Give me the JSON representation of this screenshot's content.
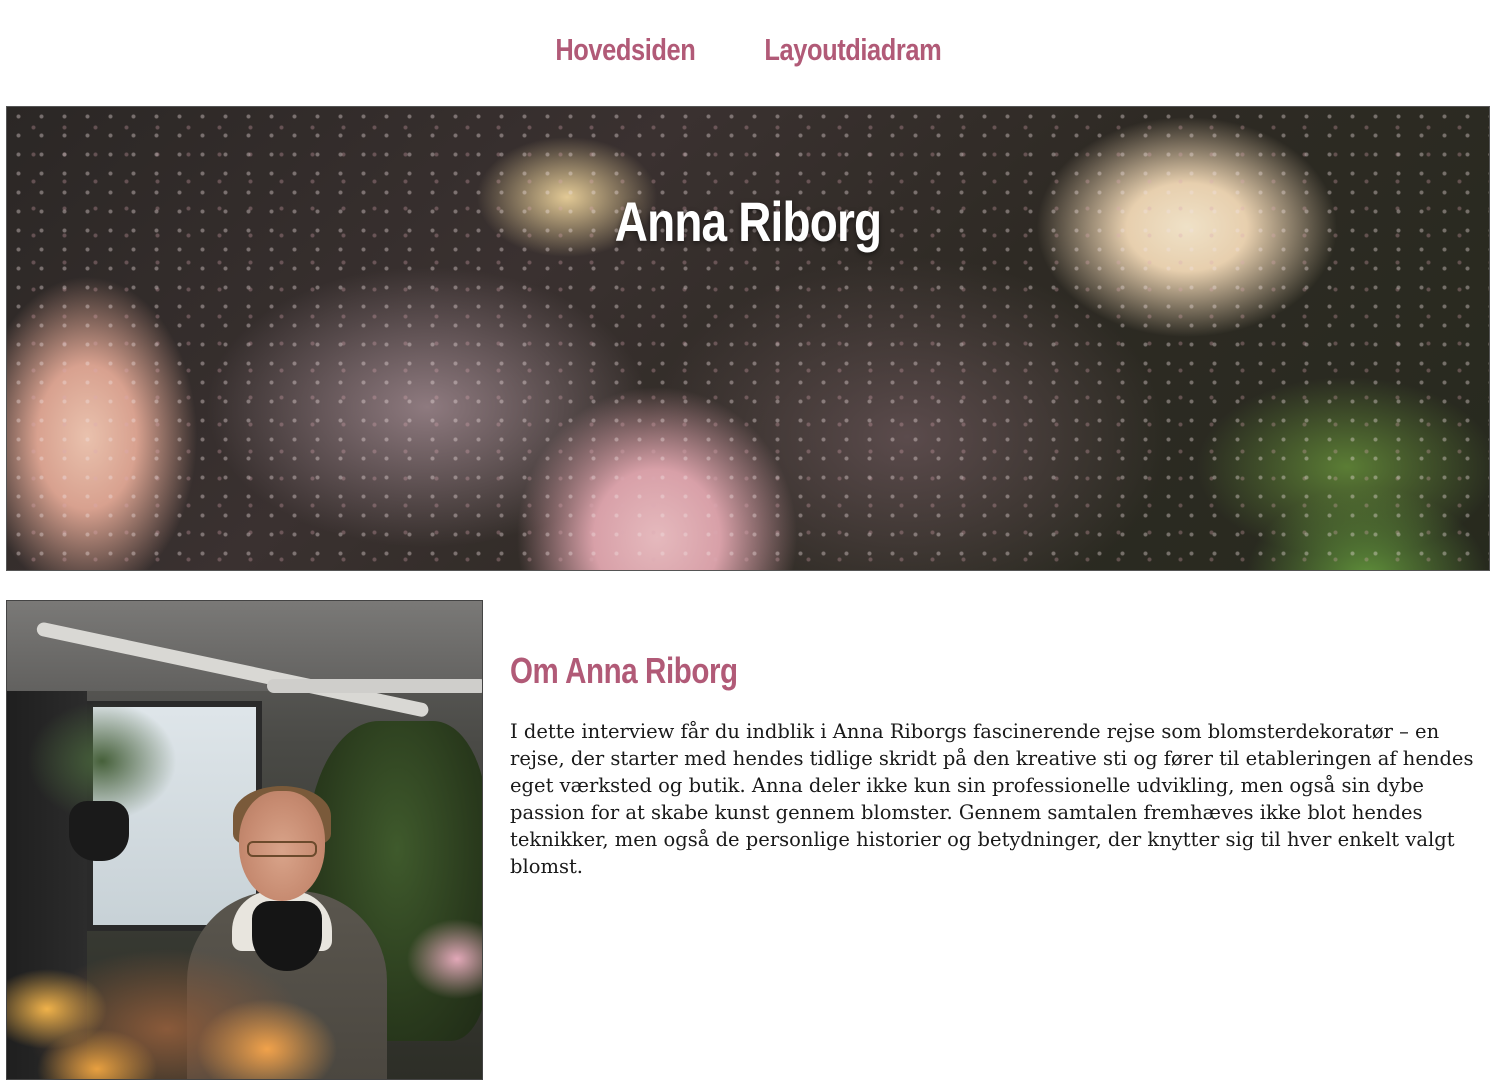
{
  "nav": {
    "items": [
      {
        "label": "Hovedsiden"
      },
      {
        "label": "Layoutdiadram"
      }
    ]
  },
  "hero": {
    "title": "Anna Riborg",
    "image": "flower-arrangement-image"
  },
  "portrait": {
    "image": "anna-riborg-portrait-photo"
  },
  "about": {
    "heading": "Om Anna Riborg",
    "body": "I dette interview får du indblik i Anna Riborgs fascinerende rejse som blomsterdekoratør – en rejse, der starter med hendes tidlige skridt på den kreative sti og fører til etableringen af hendes eget værksted og butik. Anna deler ikke kun sin professionelle udvikling, men også sin dybe passion for at skabe kunst gennem blomster. Gennem samtalen fremhæves ikke blot hendes teknikker, men også de personlige historier og betydninger, der knytter sig til hver enkelt valgt blomst."
  },
  "colors": {
    "accent": "#b15a77",
    "text": "#1a1a1a",
    "background": "#ffffff"
  }
}
